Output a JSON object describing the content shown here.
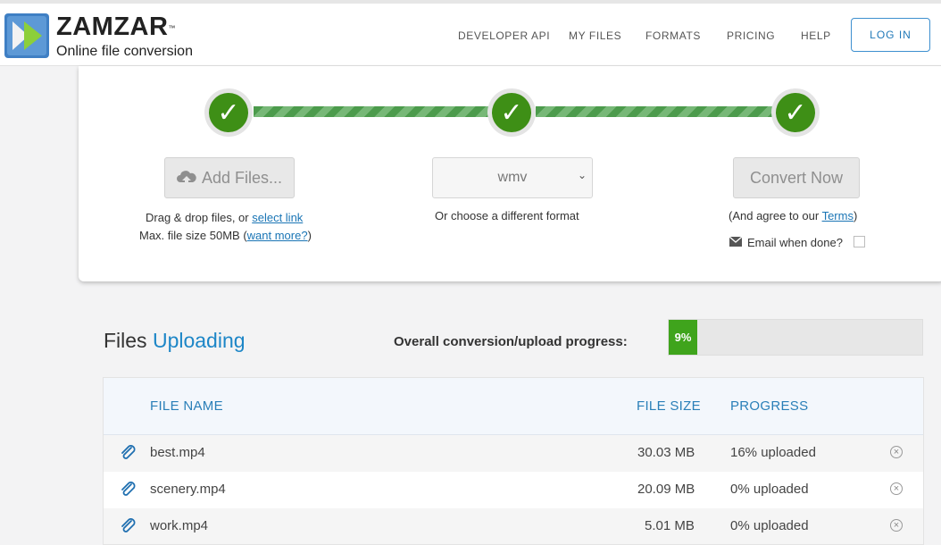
{
  "brand": {
    "name": "ZAMZAR",
    "tm": "™",
    "tagline": "Online file conversion"
  },
  "nav": {
    "items": [
      "DEVELOPER API",
      "MY FILES",
      "FORMATS",
      "PRICING",
      "HELP"
    ],
    "login": "LOG IN"
  },
  "steps": {
    "add_files_label": "Add Files...",
    "drag_text": "Drag & drop files, or ",
    "select_link": "select link",
    "max_text_prefix": "Max. file size 50MB (",
    "want_more_link": "want more?",
    "max_text_suffix": ")",
    "format_value": "wmv",
    "format_hint": "Or choose a different format",
    "convert_label": "Convert Now",
    "agree_prefix": "(And agree to our ",
    "terms_link": "Terms",
    "agree_suffix": ")",
    "email_label": "Email when done?",
    "check_mark": "✓"
  },
  "uploading": {
    "title_prefix": "Files ",
    "title_highlight": "Uploading",
    "overall_label": "Overall conversion/upload progress:",
    "overall_percent_text": "9%",
    "overall_percent_value": 9
  },
  "table": {
    "headers": {
      "name": "FILE NAME",
      "size": "FILE SIZE",
      "progress": "PROGRESS"
    },
    "rows": [
      {
        "name": "best.mp4",
        "size": "30.03 MB",
        "progress": "16% uploaded"
      },
      {
        "name": "scenery.mp4",
        "size": "20.09 MB",
        "progress": "0% uploaded"
      },
      {
        "name": "work.mp4",
        "size": "5.01 MB",
        "progress": "0% uploaded"
      }
    ]
  },
  "colors": {
    "accent": "#1d86c7",
    "success": "#3e8f16",
    "progress_fill": "#3fa41c"
  }
}
